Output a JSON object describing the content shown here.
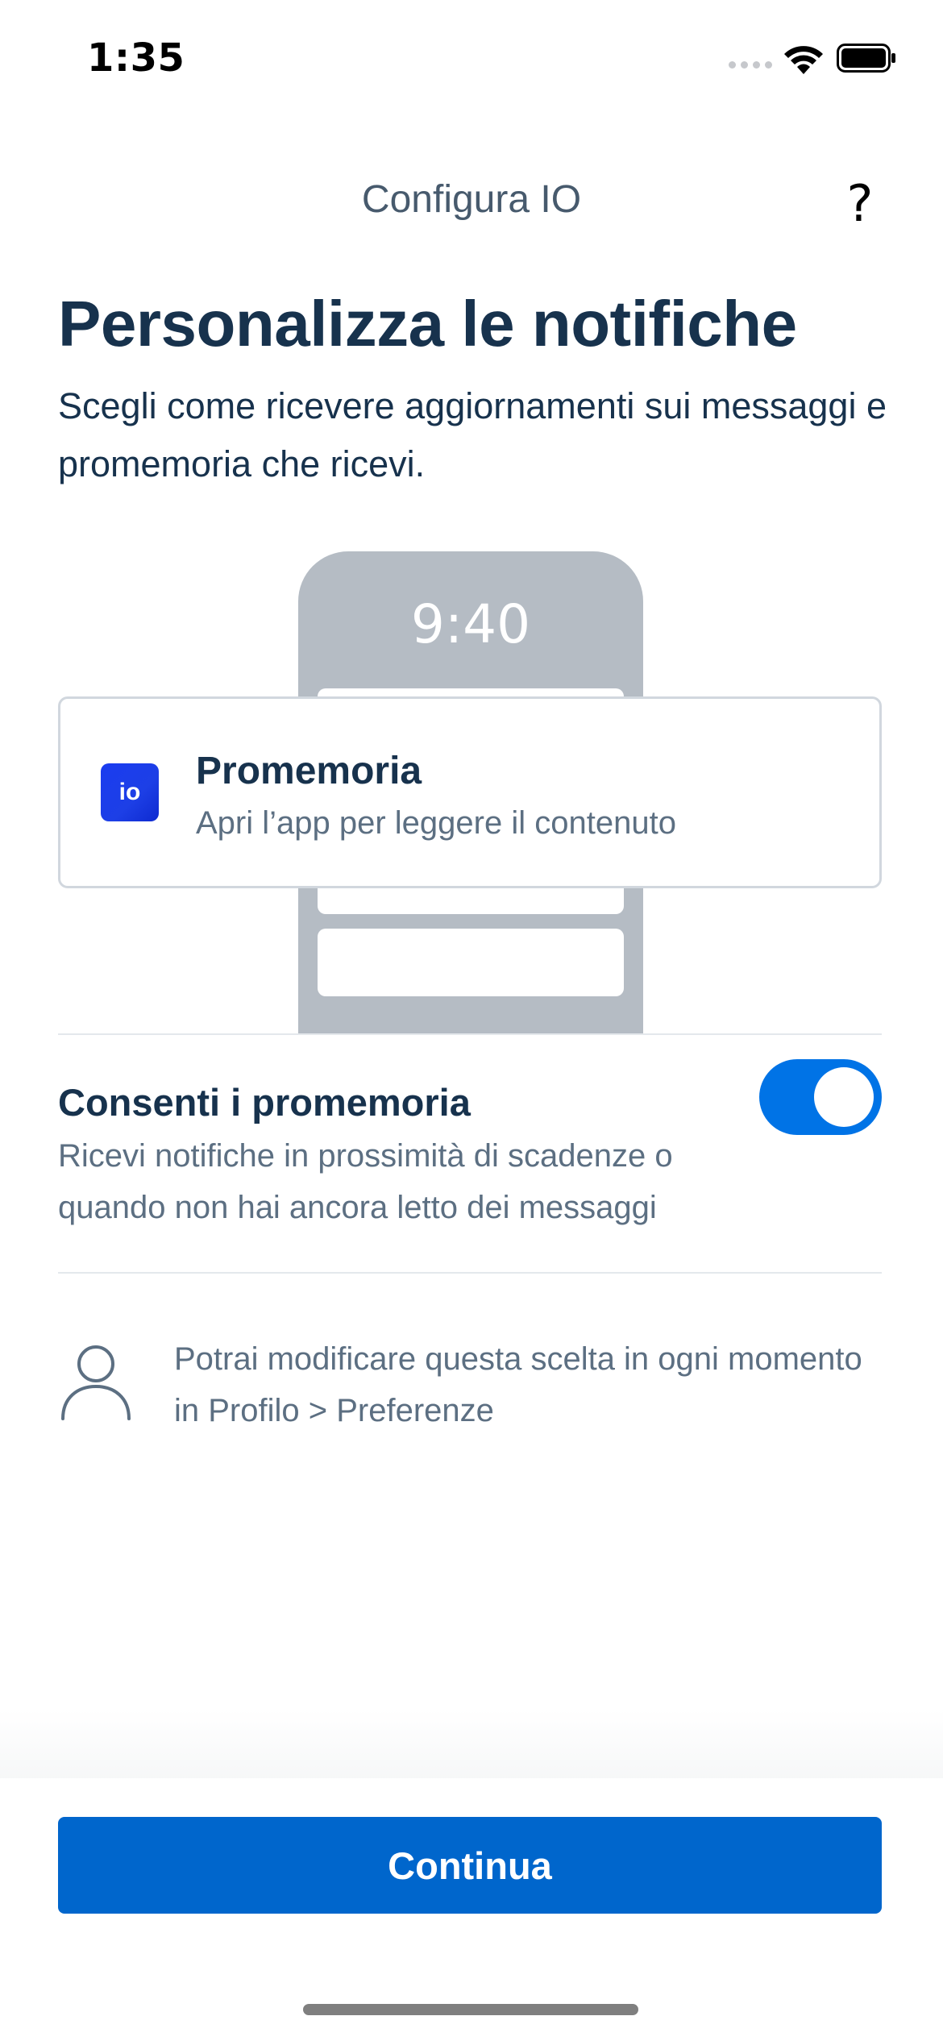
{
  "status_bar": {
    "time": "1:35"
  },
  "header": {
    "title": "Configura IO",
    "help_glyph": "?"
  },
  "main": {
    "title": "Personalizza le notifiche",
    "subtitle": "Scegli come ricevere aggiornamenti sui messaggi e promemoria che ricevi."
  },
  "illustration": {
    "phone_time": "9:40",
    "notification": {
      "app_icon_label": "io",
      "title": "Promemoria",
      "body": "Apri l’app per leggere il contenuto"
    }
  },
  "setting": {
    "title": "Consenti i promemoria",
    "description": "Ricevi notifiche in prossimità di scadenze o quando non hai ancora letto dei messaggi",
    "enabled": true
  },
  "info": {
    "text": "Potrai modificare questa scelta in ogni momento in Profilo > Preferenze",
    "icon": "user-icon"
  },
  "footer": {
    "continue_label": "Continua"
  },
  "colors": {
    "primary": "#0066cc",
    "toggle_on": "#0073e6",
    "text_dark": "#17324d",
    "text_muted": "#5c6f82"
  }
}
